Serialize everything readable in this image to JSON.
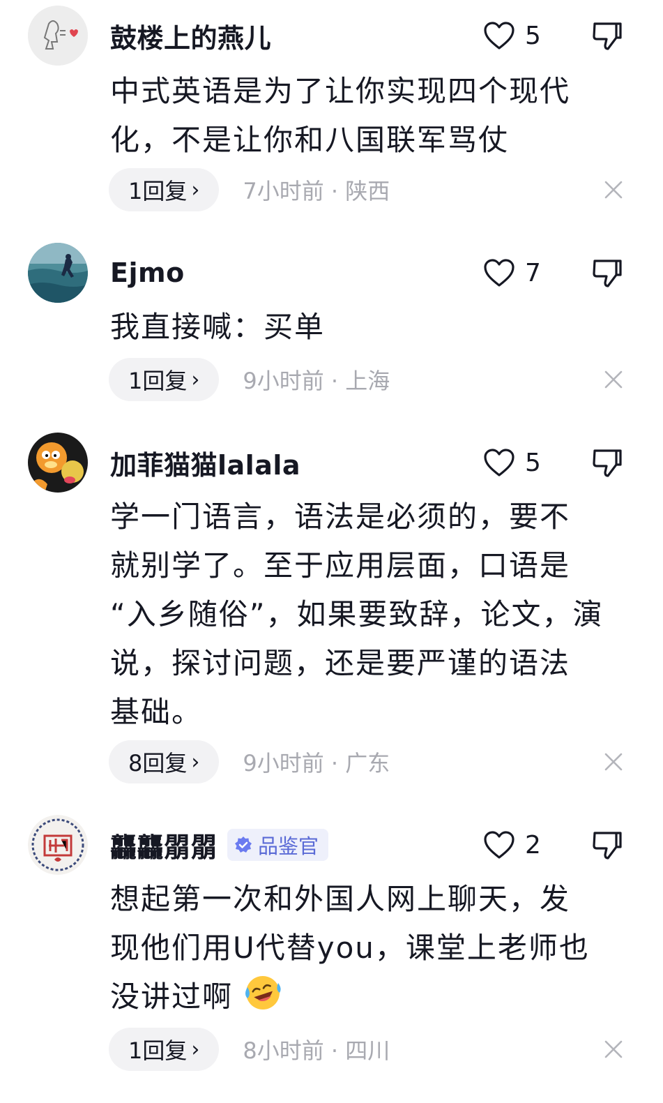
{
  "comments": [
    {
      "username": "鼓楼上的燕儿",
      "likes": "5",
      "lines": [
        "中式英语是为了让你实现四个现代",
        "化，不是让你和八国联军骂仗"
      ],
      "reply_label": "1回复",
      "time_location": "7小时前 · 陕西",
      "avatar_icon": "doodle-avatar-icon"
    },
    {
      "username": "Ejmo",
      "likes": "7",
      "lines": [
        "我直接喊：买单"
      ],
      "reply_label": "1回复",
      "time_location": "9小时前 · 上海",
      "avatar_icon": "ocean-avatar-icon"
    },
    {
      "username": "加菲猫猫lalala",
      "likes": "5",
      "lines": [
        "学一门语言，语法是必须的，要不",
        "就别学了。至于应用层面，口语是",
        "“入乡随俗”，如果要致辞，论文，演",
        "说，探讨问题，还是要严谨的语法",
        "基础。"
      ],
      "reply_label": "8回复",
      "time_location": "9小时前 · 广东",
      "avatar_icon": "garfield-avatar-icon"
    },
    {
      "username": "龘龘朤朤",
      "badge": "品鉴官",
      "likes": "2",
      "lines": [
        "想起第一次和外国人网上聊天，发",
        "现他们用U代替you，课堂上老师也",
        "没讲过啊"
      ],
      "emoji": "crying-laughing-emoji",
      "reply_label": "1回复",
      "time_location": "8小时前 · 四川",
      "avatar_icon": "seal-avatar-icon"
    }
  ],
  "icons": {
    "like": "heart-outline-icon",
    "dislike": "thumbs-down-icon",
    "reply_chevron": "chevron-right-icon",
    "close": "close-icon"
  },
  "colors": {
    "text": "#161823",
    "muted": "#a8a9b0",
    "pill_bg": "#f2f2f4",
    "badge_bg": "#eef0fb",
    "badge_text": "#5a6ad6"
  }
}
